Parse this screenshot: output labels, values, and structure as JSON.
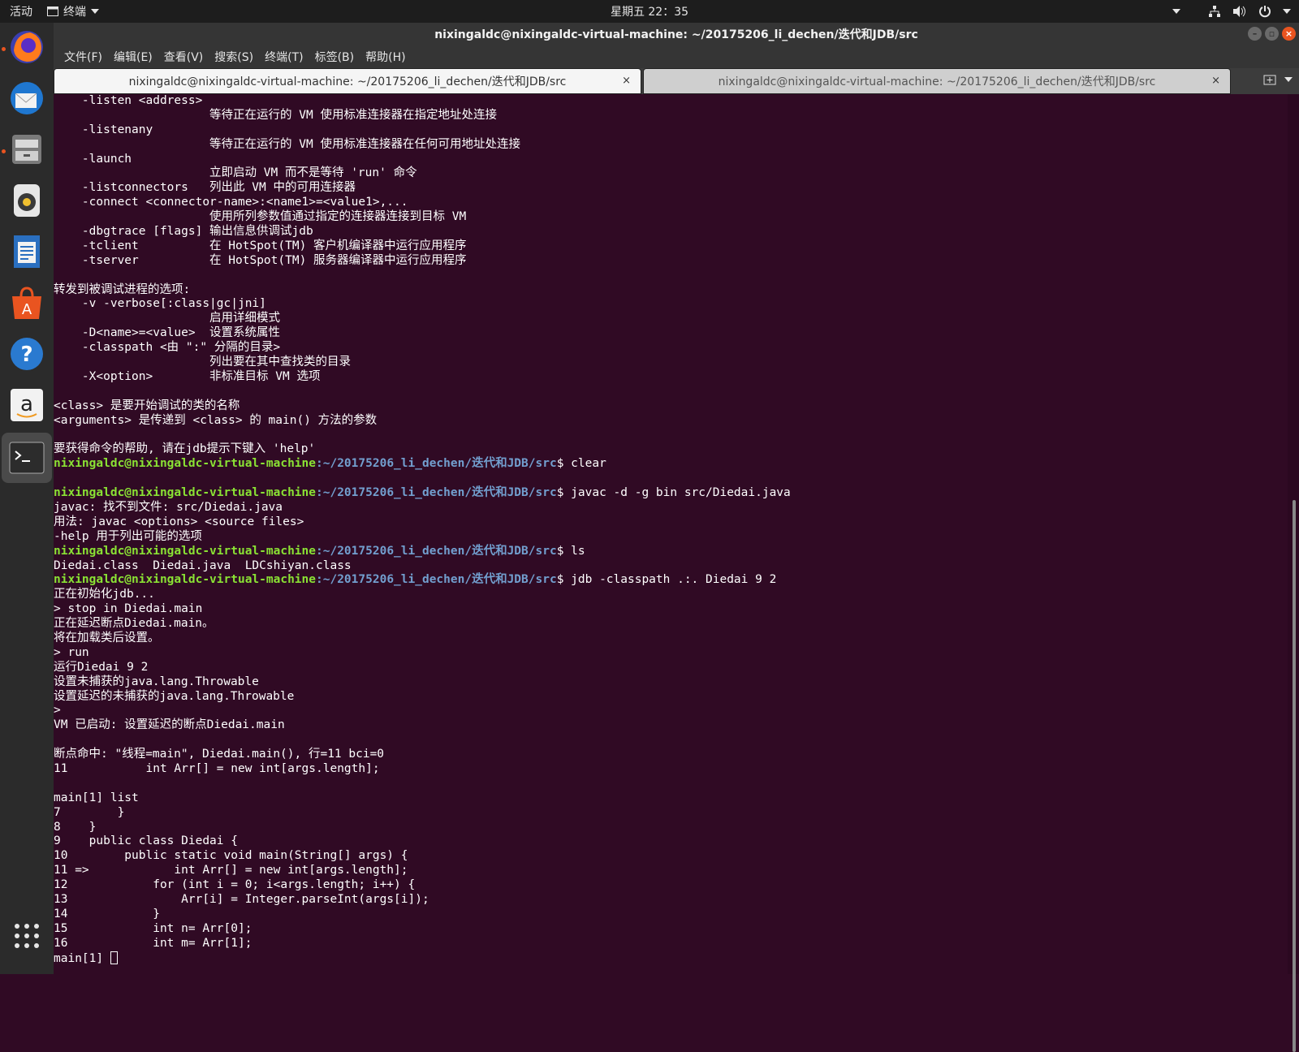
{
  "topbar": {
    "activities": "活动",
    "app_label": "终端",
    "clock": "星期五 22：35"
  },
  "window": {
    "title": "nixingaldc@nixingaldc-virtual-machine: ~/20175206_li_dechen/迭代和JDB/src"
  },
  "menubar": {
    "items": [
      "文件(F)",
      "编辑(E)",
      "查看(V)",
      "搜索(S)",
      "终端(T)",
      "标签(B)",
      "帮助(H)"
    ]
  },
  "tabs": [
    {
      "title": "nixingaldc@nixingaldc-virtual-machine: ~/20175206_li_dechen/迭代和JDB/src",
      "close": "×"
    },
    {
      "title": "nixingaldc@nixingaldc-virtual-machine: ~/20175206_li_dechen/迭代和JDB/src",
      "close": "×"
    }
  ],
  "terminal": {
    "prompt_user": "nixingaldc@nixingaldc-virtual-machine",
    "prompt_path": ":~/20175206_li_dechen/迭代和JDB/src",
    "lines": [
      {
        "t": "    -listen <address>"
      },
      {
        "t": "                      等待正在运行的 VM 使用标准连接器在指定地址处连接"
      },
      {
        "t": "    -listenany"
      },
      {
        "t": "                      等待正在运行的 VM 使用标准连接器在任何可用地址处连接"
      },
      {
        "t": "    -launch"
      },
      {
        "t": "                      立即启动 VM 而不是等待 'run' 命令"
      },
      {
        "t": "    -listconnectors   列出此 VM 中的可用连接器"
      },
      {
        "t": "    -connect <connector-name>:<name1>=<value1>,..."
      },
      {
        "t": "                      使用所列参数值通过指定的连接器连接到目标 VM"
      },
      {
        "t": "    -dbgtrace [flags] 输出信息供调试jdb"
      },
      {
        "t": "    -tclient          在 HotSpot(TM) 客户机编译器中运行应用程序"
      },
      {
        "t": "    -tserver          在 HotSpot(TM) 服务器编译器中运行应用程序"
      },
      {
        "t": ""
      },
      {
        "t": "转发到被调试进程的选项:"
      },
      {
        "t": "    -v -verbose[:class|gc|jni]"
      },
      {
        "t": "                      启用详细模式"
      },
      {
        "t": "    -D<name>=<value>  设置系统属性"
      },
      {
        "t": "    -classpath <由 \":\" 分隔的目录>"
      },
      {
        "t": "                      列出要在其中查找类的目录"
      },
      {
        "t": "    -X<option>        非标准目标 VM 选项"
      },
      {
        "t": ""
      },
      {
        "t": "<class> 是要开始调试的类的名称"
      },
      {
        "t": "<arguments> 是传递到 <class> 的 main() 方法的参数"
      },
      {
        "t": ""
      },
      {
        "t": "要获得命令的帮助, 请在jdb提示下键入 'help'"
      },
      {
        "p": true,
        "t": "$ clear"
      },
      {
        "t": ""
      },
      {
        "p": true,
        "t": "$ javac -d -g bin src/Diedai.java"
      },
      {
        "t": "javac: 找不到文件: src/Diedai.java"
      },
      {
        "t": "用法: javac <options> <source files>"
      },
      {
        "t": "-help 用于列出可能的选项"
      },
      {
        "p": true,
        "t": "$ ls"
      },
      {
        "t": "Diedai.class  Diedai.java  LDCshiyan.class"
      },
      {
        "p": true,
        "t": "$ jdb -classpath .:. Diedai 9 2"
      },
      {
        "t": "正在初始化jdb..."
      },
      {
        "t": "> stop in Diedai.main"
      },
      {
        "t": "正在延迟断点Diedai.main。"
      },
      {
        "t": "将在加载类后设置。"
      },
      {
        "t": "> run"
      },
      {
        "t": "运行Diedai 9 2"
      },
      {
        "t": "设置未捕获的java.lang.Throwable"
      },
      {
        "t": "设置延迟的未捕获的java.lang.Throwable"
      },
      {
        "t": ">"
      },
      {
        "t": "VM 已启动: 设置延迟的断点Diedai.main"
      },
      {
        "t": ""
      },
      {
        "t": "断点命中: \"线程=main\", Diedai.main(), 行=11 bci=0"
      },
      {
        "t": "11\t       int Arr[] = new int[args.length];"
      },
      {
        "t": ""
      },
      {
        "t": "main[1] list"
      },
      {
        "t": "7\t    }"
      },
      {
        "t": "8\t}"
      },
      {
        "t": "9\tpublic class Diedai {"
      },
      {
        "t": "10\t    public static void main(String[] args) {"
      },
      {
        "t": "11 =>\t        int Arr[] = new int[args.length];"
      },
      {
        "t": "12\t        for (int i = 0; i<args.length; i++) {"
      },
      {
        "t": "13\t            Arr[i] = Integer.parseInt(args[i]);"
      },
      {
        "t": "14\t        }"
      },
      {
        "t": "15\t        int n= Arr[0];"
      },
      {
        "t": "16\t        int m= Arr[1];"
      },
      {
        "t": "main[1] ",
        "cursor": true
      }
    ]
  },
  "dock": {
    "items": [
      "firefox-icon",
      "thunderbird-icon",
      "files-icon",
      "rhythmbox-icon",
      "writer-icon",
      "software-icon",
      "help-icon",
      "amazon-icon",
      "terminal-icon"
    ],
    "show_apps": "show-apps-icon"
  },
  "colors": {
    "terminal_bg": "#300a24",
    "prompt_user": "#8ae234",
    "prompt_path": "#729fcf",
    "accent": "#e95420"
  }
}
